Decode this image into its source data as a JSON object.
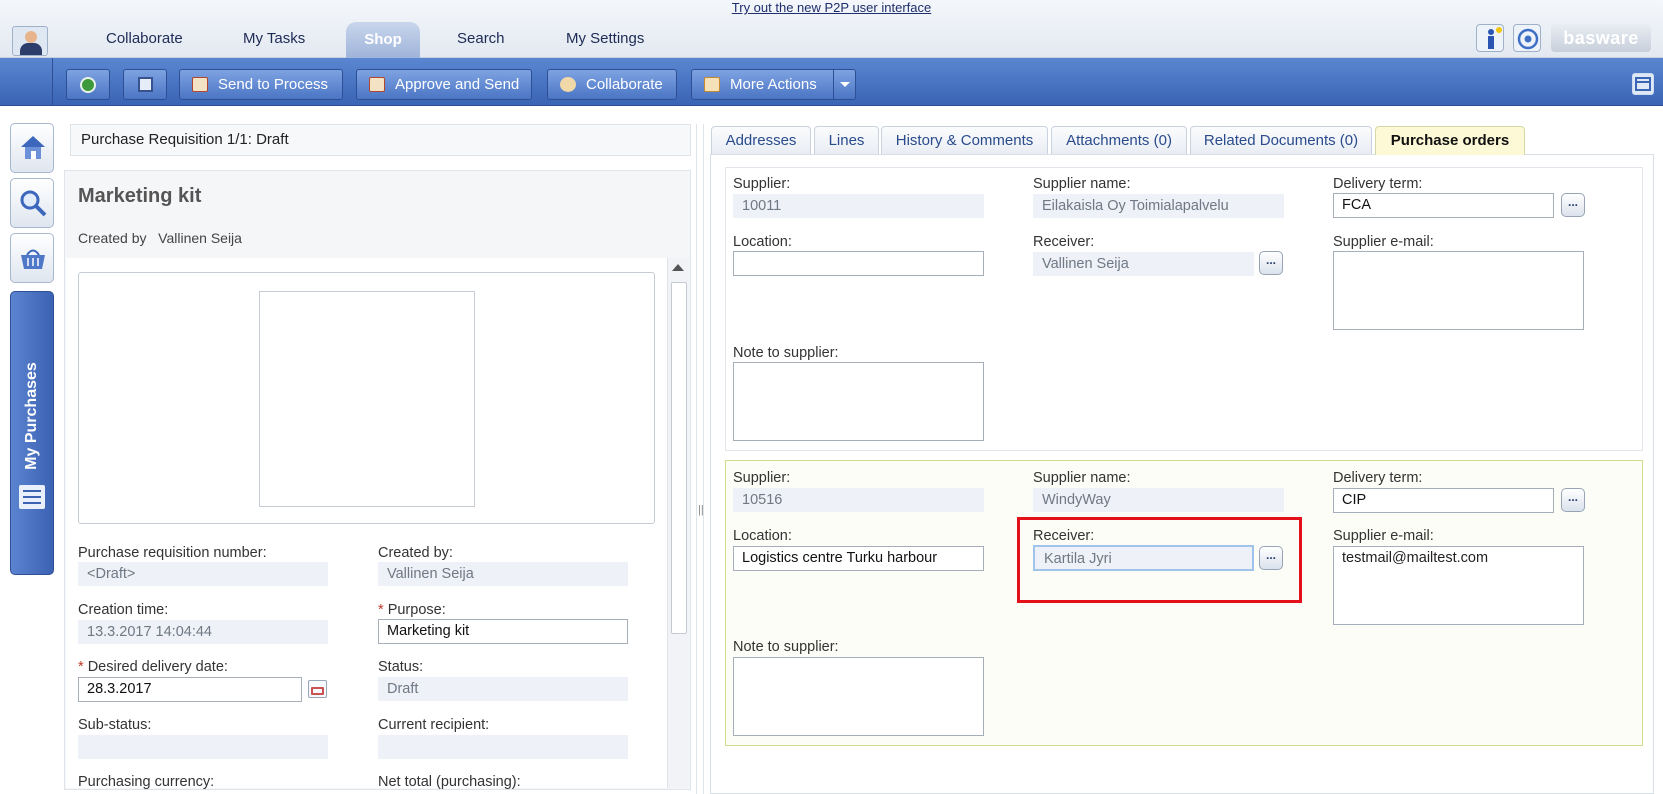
{
  "banner": {
    "link": "Try out the new P2P user interface"
  },
  "nav": {
    "tabs": [
      "Collaborate",
      "My Tasks",
      "Shop",
      "Search",
      "My Settings"
    ],
    "active": "Shop",
    "logo": "basware"
  },
  "toolbar": {
    "send_to_process": "Send to Process",
    "approve_and_send": "Approve and Send",
    "collaborate": "Collaborate",
    "more_actions": "More Actions"
  },
  "rail": {
    "my_purchases": "My Purchases"
  },
  "left": {
    "header": "Purchase Requisition 1/1: Draft",
    "title": "Marketing kit",
    "created_by_label": "Created by",
    "created_by_value": "Vallinen Seija",
    "fields": {
      "pr_number_label": "Purchase requisition number:",
      "pr_number": "<Draft>",
      "created_by_label": "Created by:",
      "created_by": "Vallinen Seija",
      "creation_time_label": "Creation time:",
      "creation_time": "13.3.2017 14:04:44",
      "purpose_label": "Purpose:",
      "purpose": "Marketing kit",
      "desired_date_label": "Desired delivery date:",
      "desired_date": "28.3.2017",
      "status_label": "Status:",
      "status": "Draft",
      "substatus_label": "Sub-status:",
      "substatus": "",
      "current_recipient_label": "Current recipient:",
      "current_recipient": "",
      "purchasing_currency_label": "Purchasing currency:",
      "net_total_label": "Net total (purchasing):"
    },
    "required_mark": "*"
  },
  "right": {
    "tabs": [
      "Addresses",
      "Lines",
      "History & Comments",
      "Attachments (0)",
      "Related Documents (0)",
      "Purchase orders"
    ],
    "active_tab": "Purchase orders",
    "labels": {
      "supplier": "Supplier:",
      "supplier_name": "Supplier name:",
      "delivery_term": "Delivery term:",
      "location": "Location:",
      "receiver": "Receiver:",
      "supplier_email": "Supplier e-mail:",
      "note": "Note to supplier:"
    },
    "orders": [
      {
        "supplier": "10011",
        "supplier_name": "Eilakaisla Oy Toimialapalvelu",
        "delivery_term": "FCA",
        "location": "",
        "receiver": "Vallinen Seija",
        "supplier_email": "",
        "note": ""
      },
      {
        "supplier": "10516",
        "supplier_name": "WindyWay",
        "delivery_term": "CIP",
        "location": "Logistics centre Turku harbour",
        "receiver": "Kartila Jyri",
        "supplier_email": "testmail@mailtest.com",
        "note": ""
      }
    ],
    "dots": "..."
  },
  "colors": {
    "toolbar": "#3a64b4",
    "active_tab": "#fdf8d5",
    "highlight": "#e3121a",
    "selected_order_border": "#d2dd8a"
  },
  "icons": [
    "user-avatar-icon",
    "info-icon",
    "help-icon",
    "back-icon",
    "save-icon",
    "send-icon",
    "approve-icon",
    "collaborate-icon",
    "more-actions-icon",
    "dropdown-arrow-icon",
    "panel-toggle-icon",
    "home-icon",
    "search-icon",
    "basket-icon",
    "purchases-list-icon",
    "calendar-icon"
  ]
}
